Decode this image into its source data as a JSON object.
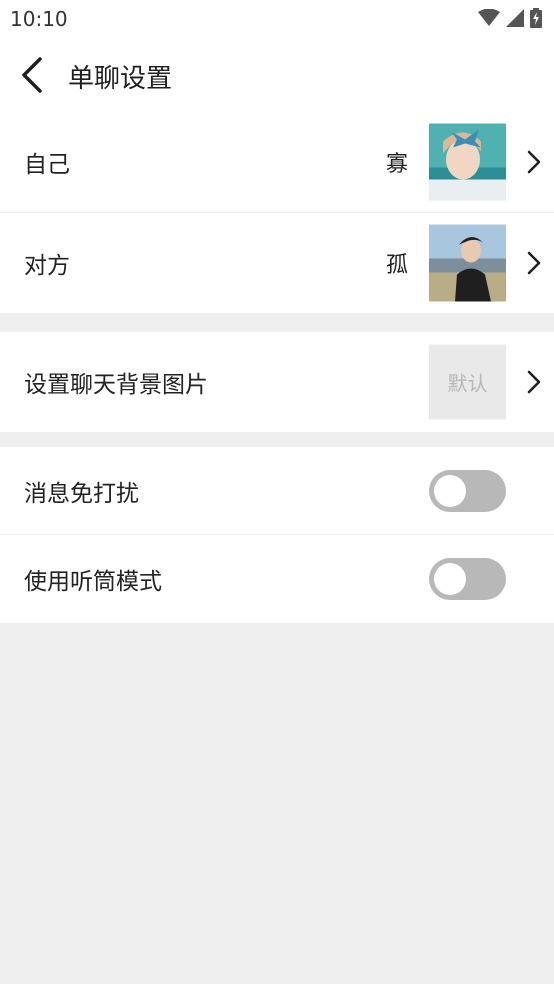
{
  "status": {
    "time": "10:10"
  },
  "header": {
    "title": "单聊设置"
  },
  "profile": {
    "self_label": "自己",
    "self_name": "寡",
    "other_label": "对方",
    "other_name": "孤"
  },
  "background": {
    "label": "设置聊天背景图片",
    "thumb_text": "默认"
  },
  "toggles": {
    "dnd_label": "消息免打扰",
    "dnd_on": false,
    "earpiece_label": "使用听筒模式",
    "earpiece_on": false
  },
  "colors": {
    "toggle_off": "#b8b8b8",
    "page_bg": "#efefef"
  }
}
